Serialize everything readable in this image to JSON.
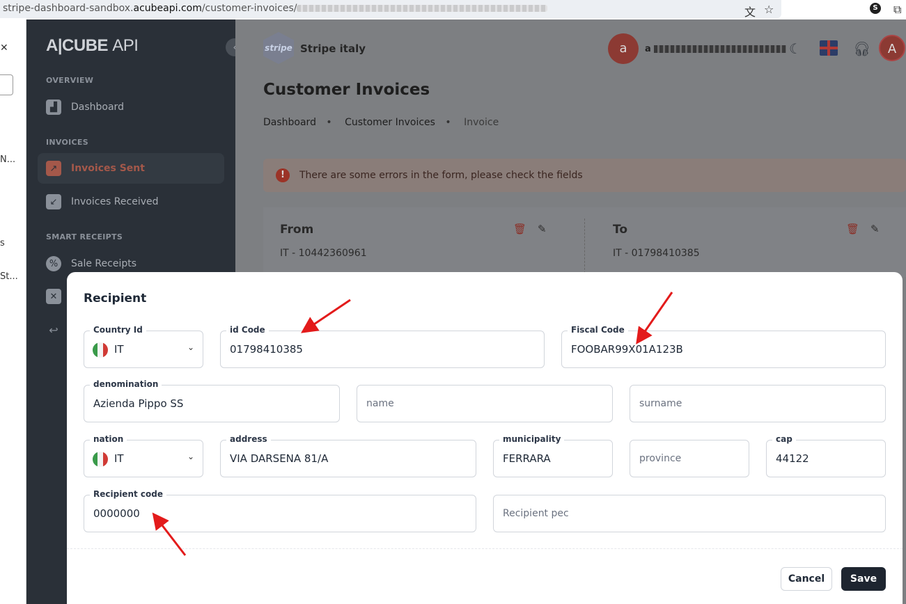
{
  "browser": {
    "url_host_prefix": "stripe-dashboard-sandbox.",
    "url_domain": "acubeapi.com",
    "url_path": "/customer-invoices/",
    "translate_icon": "translate-icon",
    "star_icon": "star-icon",
    "extension_label": "S"
  },
  "left_panel": {
    "items": [
      "N...",
      "s",
      "St..."
    ]
  },
  "sidebar": {
    "logo_main": "A|CUBE",
    "logo_sub": "API",
    "sections": {
      "overview": "OVERVIEW",
      "invoices": "INVOICES",
      "smart_receipts": "SMART RECEIPTS"
    },
    "items": [
      {
        "label": "Dashboard",
        "icon": "chart-icon"
      },
      {
        "label": "Invoices Sent",
        "icon": "arrow-up-right-icon",
        "active": true
      },
      {
        "label": "Invoices Received",
        "icon": "arrow-down-left-icon"
      },
      {
        "label": "Sale Receipts",
        "icon": "receipt-icon"
      }
    ]
  },
  "header": {
    "brand_logo_text": "stripe",
    "brand_name": "Stripe italy",
    "avatar_initial": "a",
    "user_prefix": "a",
    "account_initial": "A"
  },
  "page": {
    "title": "Customer Invoices",
    "breadcrumb": [
      "Dashboard",
      "Customer Invoices",
      "Invoice"
    ],
    "alert": "There are some errors in the form, please check the fields",
    "from": {
      "heading": "From",
      "vat": "IT - 10442360961"
    },
    "to": {
      "heading": "To",
      "vat": "IT - 01798410385"
    }
  },
  "modal": {
    "title": "Recipient",
    "country_id": {
      "label": "Country Id",
      "value": "IT"
    },
    "id_code": {
      "label": "id Code",
      "value": "01798410385"
    },
    "fiscal_code": {
      "label": "Fiscal Code",
      "value": "FOOBAR99X01A123B"
    },
    "denomination": {
      "label": "denomination",
      "value": "Azienda Pippo SS"
    },
    "name": {
      "placeholder": "name"
    },
    "surname": {
      "placeholder": "surname"
    },
    "nation": {
      "label": "nation",
      "value": "IT"
    },
    "address": {
      "label": "address",
      "value": "VIA DARSENA 81/A"
    },
    "municipality": {
      "label": "municipality",
      "value": "FERRARA"
    },
    "province": {
      "placeholder": "province"
    },
    "cap": {
      "label": "cap",
      "value": "44122"
    },
    "recipient_code": {
      "label": "Recipient code",
      "value": "0000000"
    },
    "recipient_pec": {
      "placeholder": "Recipient pec"
    },
    "cancel_label": "Cancel",
    "save_label": "Save"
  },
  "colors": {
    "sidebar_bg": "#2a3038",
    "active_accent": "#a4584a",
    "primary_button": "#1e2530",
    "annotation_arrow": "#e31b1b"
  }
}
